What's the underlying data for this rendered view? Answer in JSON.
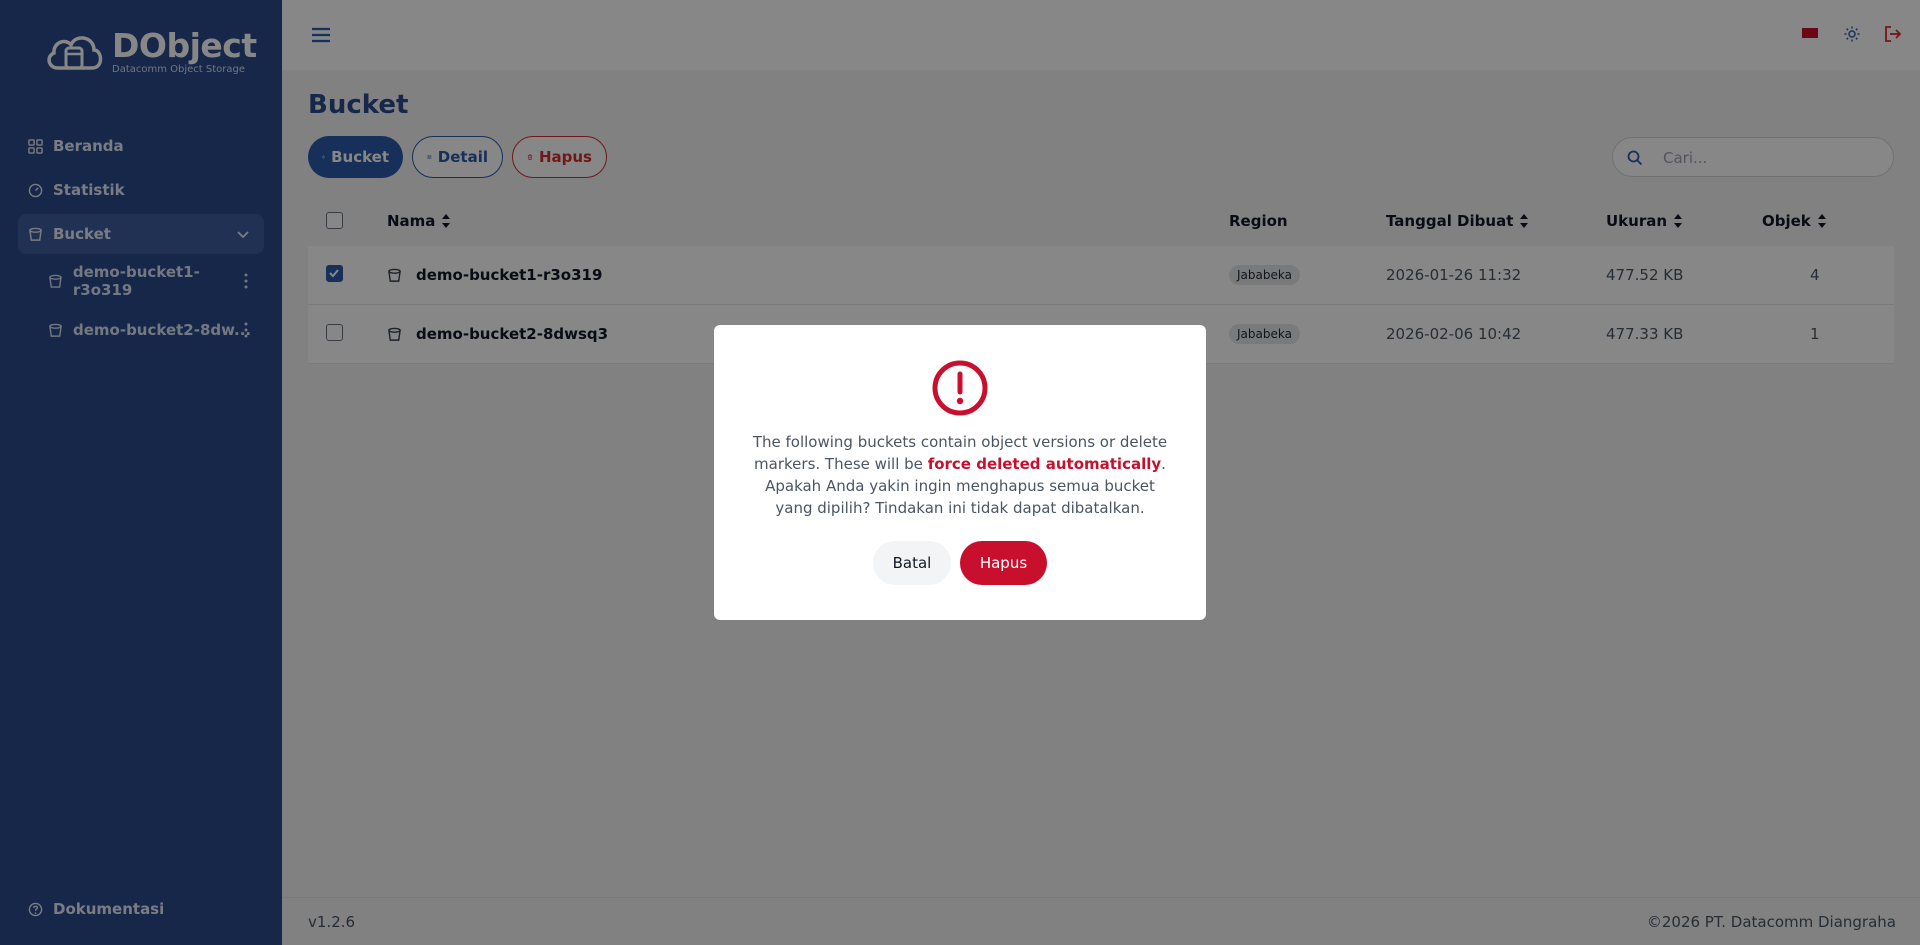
{
  "app": {
    "name": "DObject",
    "subtitle": "Datacomm Object Storage",
    "version": "v1.2.6",
    "copyright": "©2026 PT. Datacomm Diangraha"
  },
  "sidebar": {
    "items": [
      {
        "label": "Beranda",
        "icon": "grid-icon"
      },
      {
        "label": "Statistik",
        "icon": "gauge-icon"
      },
      {
        "label": "Bucket",
        "icon": "bucket-icon",
        "expanded": true
      }
    ],
    "sub_items": [
      {
        "label": "demo-bucket1-r3o319"
      },
      {
        "label": "demo-bucket2-8dw..."
      }
    ],
    "bottom": {
      "label": "Dokumentasi",
      "icon": "help-circle-icon"
    }
  },
  "page": {
    "title": "Bucket",
    "toolbar": {
      "add_label": "Bucket",
      "detail_label": "Detail",
      "delete_label": "Hapus"
    },
    "search_placeholder": "Cari..."
  },
  "table": {
    "columns": [
      "Nama",
      "Region",
      "Tanggal Dibuat",
      "Ukuran",
      "Objek"
    ],
    "rows": [
      {
        "checked": true,
        "name": "demo-bucket1-r3o319",
        "region": "Jababeka",
        "created": "2026-01-26 11:32",
        "size": "477.52 KB",
        "objects": "4"
      },
      {
        "checked": false,
        "name": "demo-bucket2-8dwsq3",
        "region": "Jababeka",
        "created": "2026-02-06 10:42",
        "size": "477.33 KB",
        "objects": "1"
      }
    ]
  },
  "modal": {
    "message_part1": "The following buckets contain object versions or delete markers. These will be ",
    "message_highlight": "force deleted automatically",
    "message_part2": ". Apakah Anda yakin ingin menghapus semua bucket yang dipilih? Tindakan ini tidak dapat dibatalkan.",
    "cancel_label": "Batal",
    "confirm_label": "Hapus"
  },
  "colors": {
    "sidebar_bg": "#2b4a8c",
    "primary": "#2b5cab",
    "danger": "#c8102e"
  }
}
